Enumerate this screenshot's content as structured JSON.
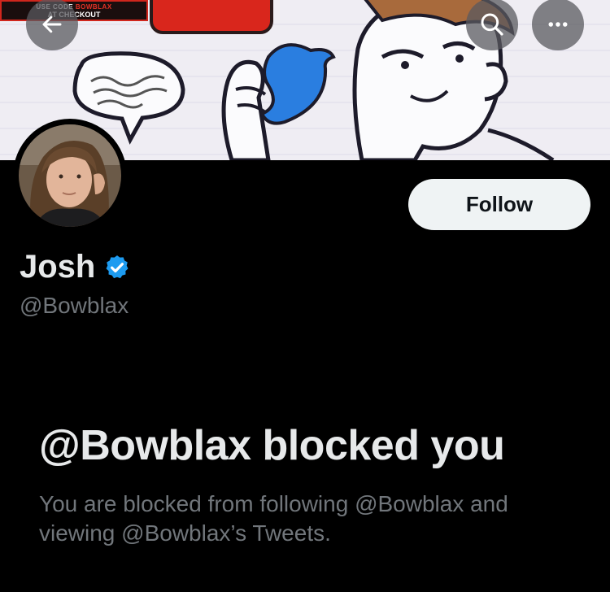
{
  "banner": {
    "promo_line1_a": "USE CODE ",
    "promo_line1_b": "BOWBLAX",
    "promo_line2": "AT CHECKOUT"
  },
  "nav": {
    "back_icon": "arrow-left-icon",
    "search_icon": "search-icon",
    "more_icon": "more-horizontal-icon"
  },
  "profile": {
    "display_name": "Josh",
    "handle": "@Bowblax",
    "verified": true,
    "verified_color": "#1d9bf0",
    "follow_label": "Follow"
  },
  "blocked": {
    "title": "@Bowblax blocked you",
    "description": "You are blocked from following @Bowblax and viewing @Bowblax’s Tweets."
  }
}
